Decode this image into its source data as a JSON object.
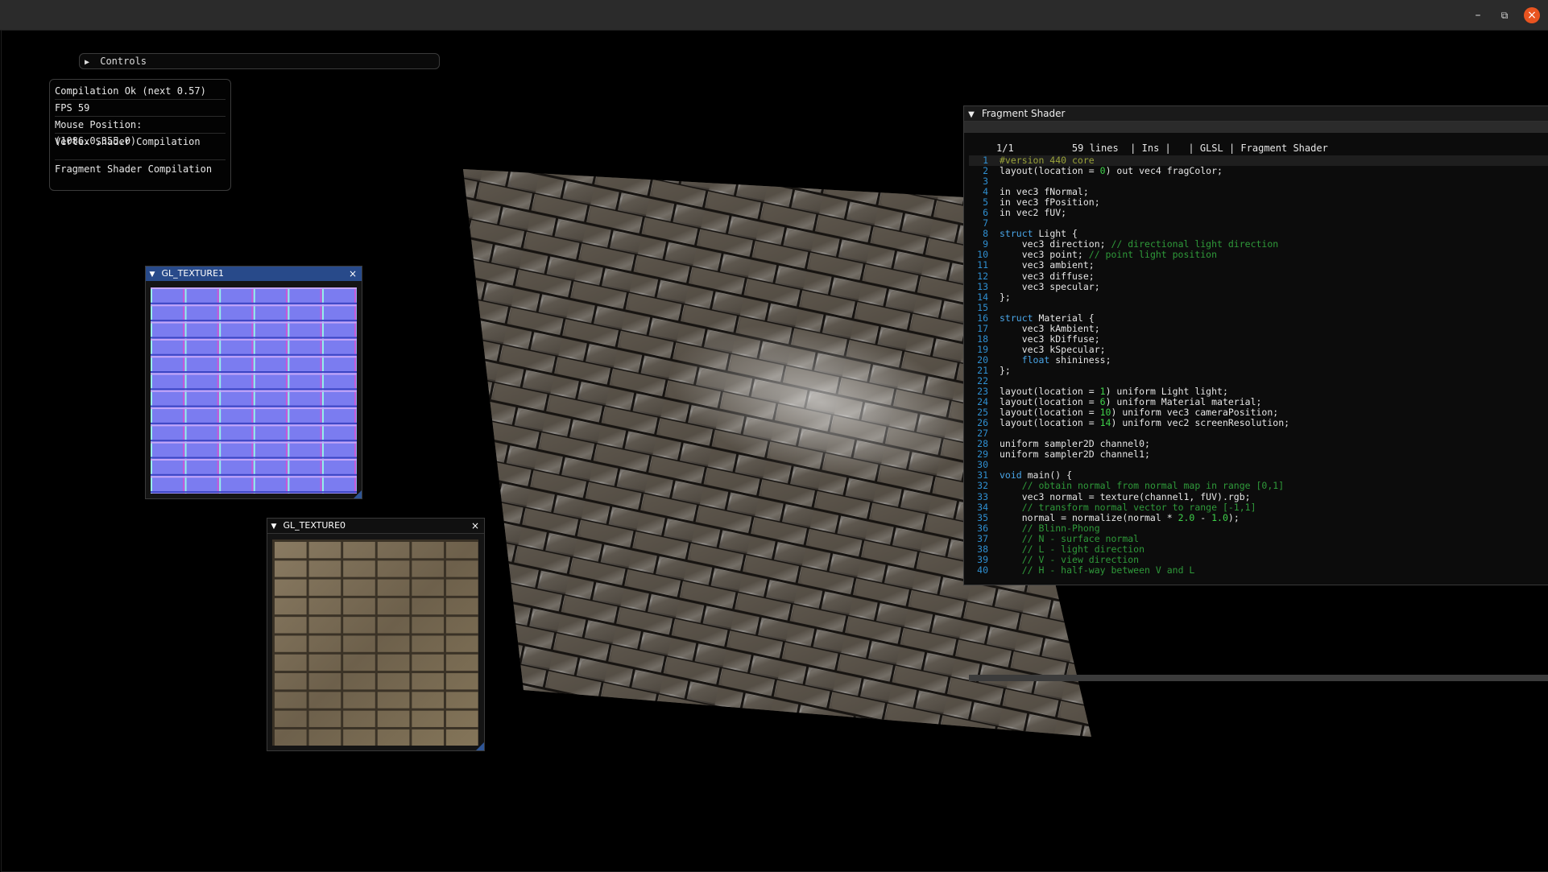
{
  "window": {
    "minimize_label": "–",
    "maximize_label": "⧉",
    "close_label": "×"
  },
  "controls": {
    "label": "Controls",
    "arrow": "▶"
  },
  "status": {
    "compilation": "Compilation Ok (next 0.57)",
    "fps": "FPS 59",
    "mouse_position": "Mouse Position: (1086.0,355.0)",
    "vertex_label": "Vertex Shader Compilation",
    "fragment_label": "Fragment Shader Compilation"
  },
  "texture1": {
    "title": "GL_TEXTURE1",
    "arrow": "▼",
    "close": "×"
  },
  "texture0": {
    "title": "GL_TEXTURE0",
    "arrow": "▼",
    "close": "×"
  },
  "shader_editor": {
    "title": "Fragment Shader",
    "arrow": "▼",
    "info": "1/1          59 lines  | Ins |   | GLSL | Fragment Shader",
    "lines": [
      "#version 440 core",
      "layout(location = 0) out vec4 fragColor;",
      "",
      "in vec3 fNormal;",
      "in vec3 fPosition;",
      "in vec2 fUV;",
      "",
      "struct Light {",
      "    vec3 direction; // directional light direction",
      "    vec3 point; // point light position",
      "    vec3 ambient;",
      "    vec3 diffuse;",
      "    vec3 specular;",
      "};",
      "",
      "struct Material {",
      "    vec3 kAmbient;",
      "    vec3 kDiffuse;",
      "    vec3 kSpecular;",
      "    float shininess;",
      "};",
      "",
      "layout(location = 1) uniform Light light;",
      "layout(location = 6) uniform Material material;",
      "layout(location = 10) uniform vec3 cameraPosition;",
      "layout(location = 14) uniform vec2 screenResolution;",
      "",
      "uniform sampler2D channel0;",
      "uniform sampler2D channel1;",
      "",
      "void main() {",
      "    // obtain normal from normal map in range [0,1]",
      "    vec3 normal = texture(channel1, fUV).rgb;",
      "    // transform normal vector to range [-1,1]",
      "    normal = normalize(normal * 2.0 - 1.0);",
      "    // Blinn-Phong",
      "    // N - surface normal",
      "    // L - light direction",
      "    // V - view direction",
      "    // H - half-way between V and L"
    ]
  }
}
